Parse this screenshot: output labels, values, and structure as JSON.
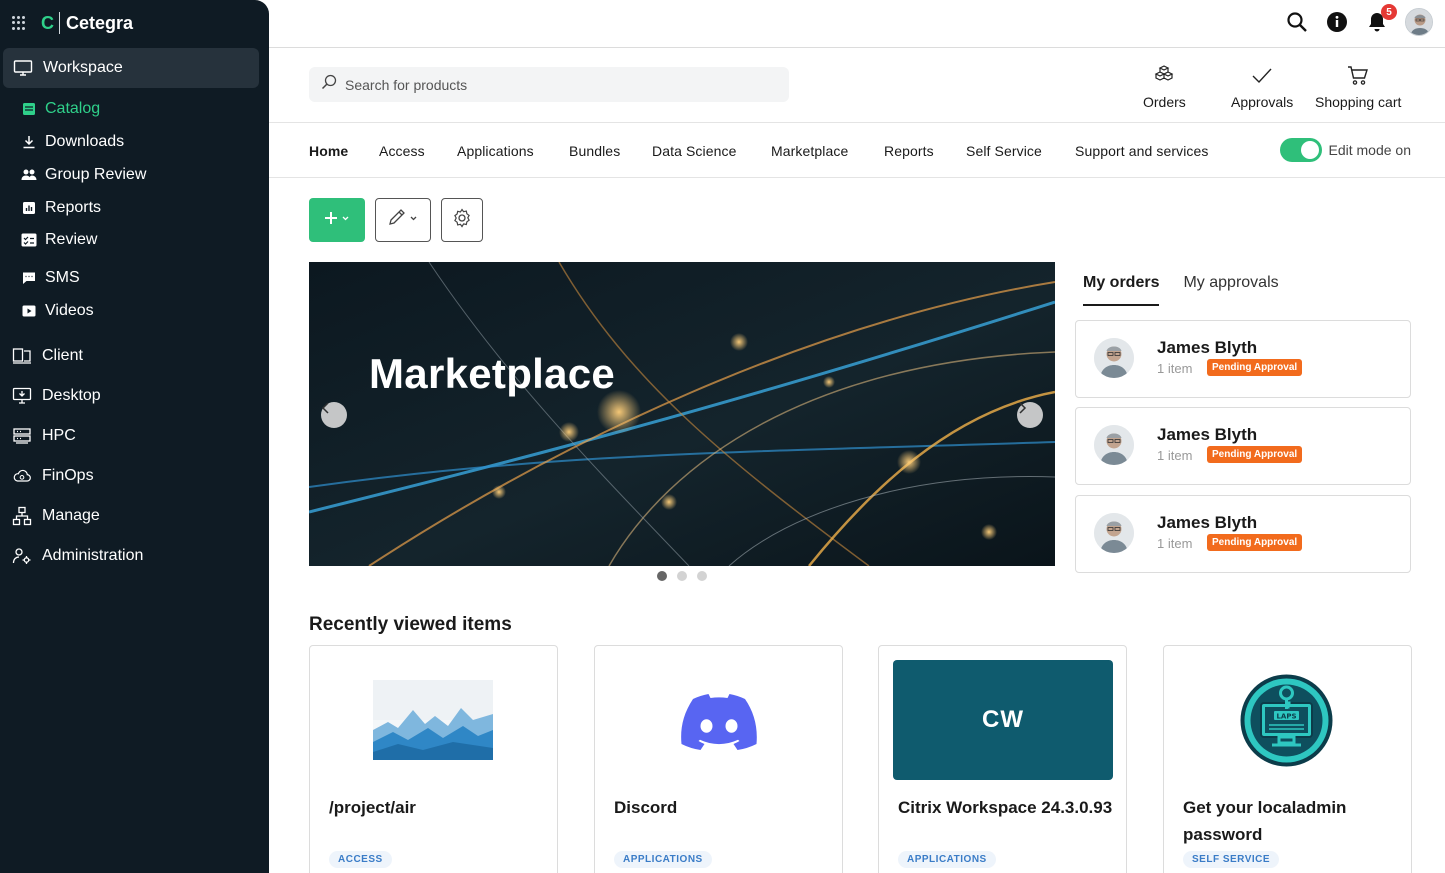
{
  "brand": {
    "letter": "C",
    "name": "Cetegra"
  },
  "sidebar": {
    "section": "Workspace",
    "items": [
      {
        "label": "Catalog",
        "active": true
      },
      {
        "label": "Downloads"
      },
      {
        "label": "Group Review"
      },
      {
        "label": "Reports"
      },
      {
        "label": "Review"
      },
      {
        "label": "SMS"
      },
      {
        "label": "Videos"
      }
    ],
    "top": [
      {
        "label": "Client"
      },
      {
        "label": "Desktop"
      },
      {
        "label": "HPC"
      },
      {
        "label": "FinOps"
      },
      {
        "label": "Manage"
      },
      {
        "label": "Administration"
      }
    ]
  },
  "topbar": {
    "notifications": "5"
  },
  "search": {
    "placeholder": "Search for products",
    "value": ""
  },
  "quick_actions": {
    "orders": "Orders",
    "approvals": "Approvals",
    "cart": "Shopping cart"
  },
  "tabs": [
    "Home",
    "Access",
    "Applications",
    "Bundles",
    "Data Science",
    "Marketplace",
    "Reports",
    "Self Service",
    "Support and services"
  ],
  "edit_mode": {
    "label": "Edit mode on",
    "on": true
  },
  "hero": {
    "title": "Marketplace",
    "slide": 1,
    "slides": 3
  },
  "orders_panel": {
    "tabs": [
      "My orders",
      "My approvals"
    ],
    "orders": [
      {
        "name": "James Blyth",
        "items": "1 item",
        "status": "Pending Approval"
      },
      {
        "name": "James Blyth",
        "items": "1 item",
        "status": "Pending Approval"
      },
      {
        "name": "James Blyth",
        "items": "1 item",
        "status": "Pending Approval"
      }
    ]
  },
  "recent": {
    "title": "Recently viewed items",
    "items": [
      {
        "title": "/project/air",
        "tag": "ACCESS"
      },
      {
        "title": "Discord",
        "tag": "APPLICATIONS"
      },
      {
        "title": "Citrix Workspace 24.3.0.93",
        "tag": "APPLICATIONS",
        "tile": "CW"
      },
      {
        "title": "Get your localadmin password",
        "tag": "SELF SERVICE",
        "logo_text": "LAPS"
      }
    ]
  },
  "colors": {
    "sidebar": "#0f1b24",
    "accent": "#2fbf7a",
    "pending": "#f26b1d",
    "cw_tile": "#0f5b6e"
  }
}
